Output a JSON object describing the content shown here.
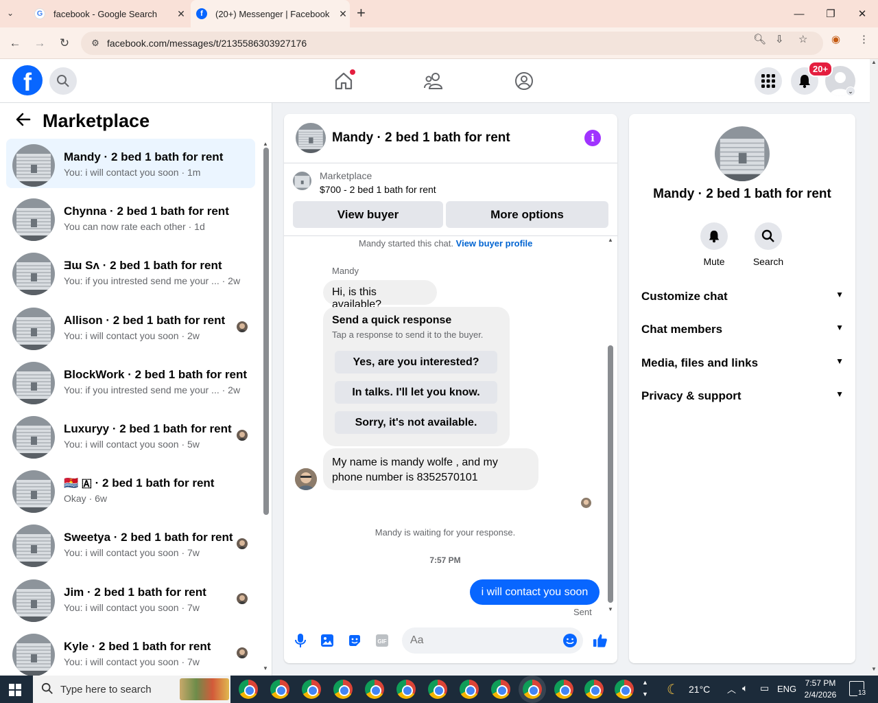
{
  "browser": {
    "tabs": [
      {
        "title": "facebook - Google Search",
        "active": false
      },
      {
        "title": "(20+) Messenger | Facebook",
        "active": true
      }
    ],
    "new_tab": "+",
    "url": "facebook.com/messages/t/2135586303927176"
  },
  "header": {
    "logo": "f",
    "notifications_badge": "20+"
  },
  "sidebar": {
    "title": "Marketplace",
    "conversations": [
      {
        "name": "Mandy · 2 bed 1 bath for rent",
        "preview": "You: i will contact you soon · 1m",
        "active": true,
        "read_avatar": false
      },
      {
        "name": "Chynna · 2 bed 1 bath for rent",
        "preview": "You can now rate each other · 1d",
        "active": false,
        "read_avatar": false
      },
      {
        "name": "Ǝɯ Sʌ · 2 bed 1 bath for rent",
        "preview": "You: if you intrested send me your ... · 2w",
        "active": false,
        "read_avatar": false
      },
      {
        "name": "Allison · 2 bed 1 bath for rent",
        "preview": "You: i will contact you soon · 2w",
        "active": false,
        "read_avatar": true
      },
      {
        "name": "BlockWork · 2 bed 1 bath for rent",
        "preview": "You: if you intrested send me your ... · 2w",
        "active": false,
        "read_avatar": false
      },
      {
        "name": "Luxuryy · 2 bed 1 bath for rent",
        "preview": "You: i will contact you soon · 5w",
        "active": false,
        "read_avatar": true
      },
      {
        "name": "🇰🇮 🇦 · 2 bed 1 bath for rent",
        "preview": "Okay · 6w",
        "active": false,
        "read_avatar": false
      },
      {
        "name": "Sweetya · 2 bed 1 bath for rent",
        "preview": "You: i will contact you soon · 7w",
        "active": false,
        "read_avatar": true
      },
      {
        "name": "Jim · 2 bed 1 bath for rent",
        "preview": "You: i will contact you soon · 7w",
        "active": false,
        "read_avatar": true
      },
      {
        "name": "Kyle · 2 bed 1 bath for rent",
        "preview": "You: i will contact you soon · 7w",
        "active": false,
        "read_avatar": true
      }
    ]
  },
  "chat": {
    "title": "Mandy · 2 bed 1 bath for rent",
    "listing_label": "Marketplace",
    "listing_desc": "$700 - 2 bed 1 bath for rent",
    "view_buyer": "View buyer",
    "more_options": "More options",
    "started_text": "Mandy started this chat.",
    "view_profile": "View buyer profile",
    "sender_name": "Mandy",
    "msg1": "Hi, is this available?",
    "quick_title": "Send a quick response",
    "quick_sub": "Tap a response to send it to the buyer.",
    "quick_responses": [
      "Yes, are you interested?",
      "In talks. I'll let you know.",
      "Sorry, it's not available."
    ],
    "msg2": "My name is mandy wolfe , and my phone number is 8352570101",
    "waiting": "Mandy is waiting for your response.",
    "time": "7:57 PM",
    "my_msg": "i will contact you soon",
    "sent": "Sent",
    "composer_placeholder": "Aa"
  },
  "details": {
    "name": "Mandy · 2 bed 1 bath for rent",
    "mute": "Mute",
    "search": "Search",
    "sections": [
      "Customize chat",
      "Chat members",
      "Media, files and links",
      "Privacy & support"
    ]
  },
  "taskbar": {
    "search_placeholder": "Type here to search",
    "temperature": "21°C",
    "language": "ENG",
    "time": "7:57 PM",
    "date": "2/4/2026",
    "notifications": "13"
  },
  "colors": {
    "fb_blue": "#0866ff",
    "tab_bg": "#f9e1d8",
    "badge_red": "#e41e3f",
    "info_purple": "#a033ff"
  }
}
